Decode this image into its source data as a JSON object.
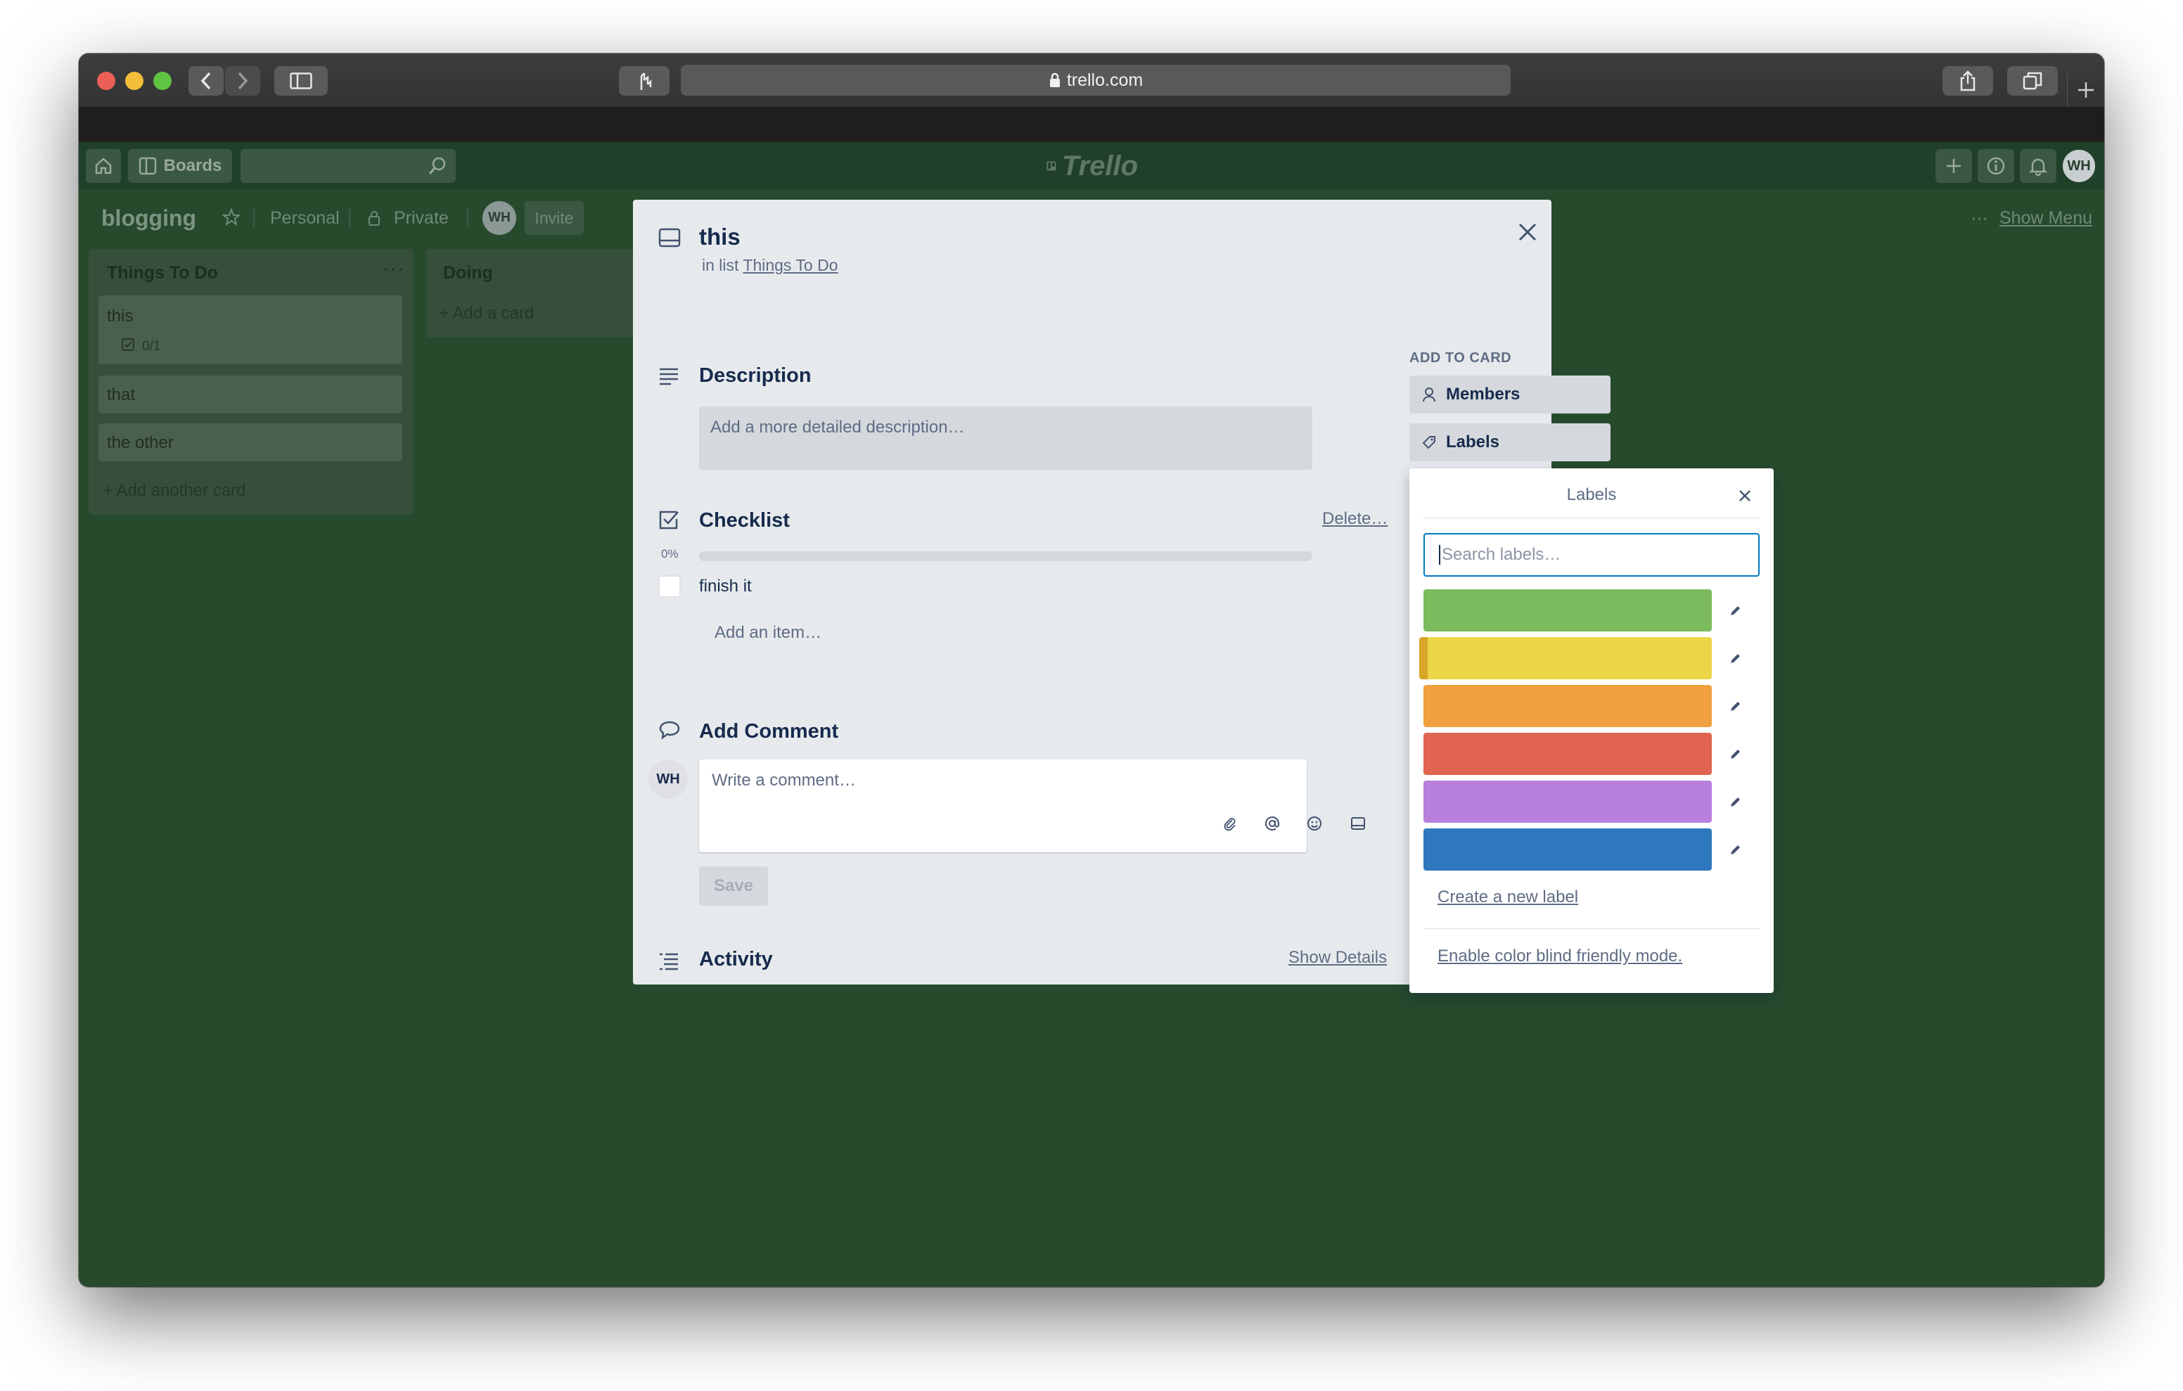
{
  "browser": {
    "url": "trello.com",
    "colors": {
      "close": "#ec5f56",
      "minimize": "#f3bd3a",
      "zoom": "#5fc443"
    }
  },
  "header": {
    "boards_label": "Boards",
    "logo_text": "Trello",
    "user_initials": "WH"
  },
  "board": {
    "title": "blogging",
    "team": "Personal",
    "visibility": "Private",
    "member_initials": "WH",
    "invite_label": "Invite",
    "menu_label": "Show Menu",
    "lists": [
      {
        "title": "Things To Do",
        "cards": [
          {
            "title": "this",
            "badge": "0/1"
          },
          {
            "title": "that"
          },
          {
            "title": "the other"
          }
        ],
        "add_label": "+ Add another card"
      },
      {
        "title": "Doing",
        "add_label": "+ Add a card"
      }
    ]
  },
  "card_modal": {
    "title": "this",
    "in_list_prefix": "in list",
    "list_name": "Things To Do",
    "description": {
      "title": "Description",
      "placeholder": "Add a more detailed description…"
    },
    "checklist": {
      "title": "Checklist",
      "delete_label": "Delete…",
      "progress_text": "0%",
      "progress_value": 0,
      "items": [
        {
          "text": "finish it",
          "checked": false
        }
      ],
      "add_item_label": "Add an item…"
    },
    "comment": {
      "title": "Add Comment",
      "avatar_initials": "WH",
      "placeholder": "Write a comment…",
      "save_label": "Save"
    },
    "activity": {
      "title": "Activity",
      "show_details_label": "Show Details"
    },
    "sidebar": {
      "heading": "ADD TO CARD",
      "members_label": "Members",
      "labels_label": "Labels"
    }
  },
  "labels_popover": {
    "title": "Labels",
    "search_placeholder": "Search labels…",
    "labels": [
      {
        "color": "#7bbb5e",
        "selected": false
      },
      {
        "color": "#ecd546",
        "selected": true,
        "mark_color": "#d8a626"
      },
      {
        "color": "#f0a03e",
        "selected": false
      },
      {
        "color": "#e06450",
        "selected": false
      },
      {
        "color": "#b97fdc",
        "selected": false
      },
      {
        "color": "#2e79bd",
        "selected": false
      }
    ],
    "create_label": "Create a new label",
    "color_blind_label": "Enable color blind friendly mode."
  }
}
